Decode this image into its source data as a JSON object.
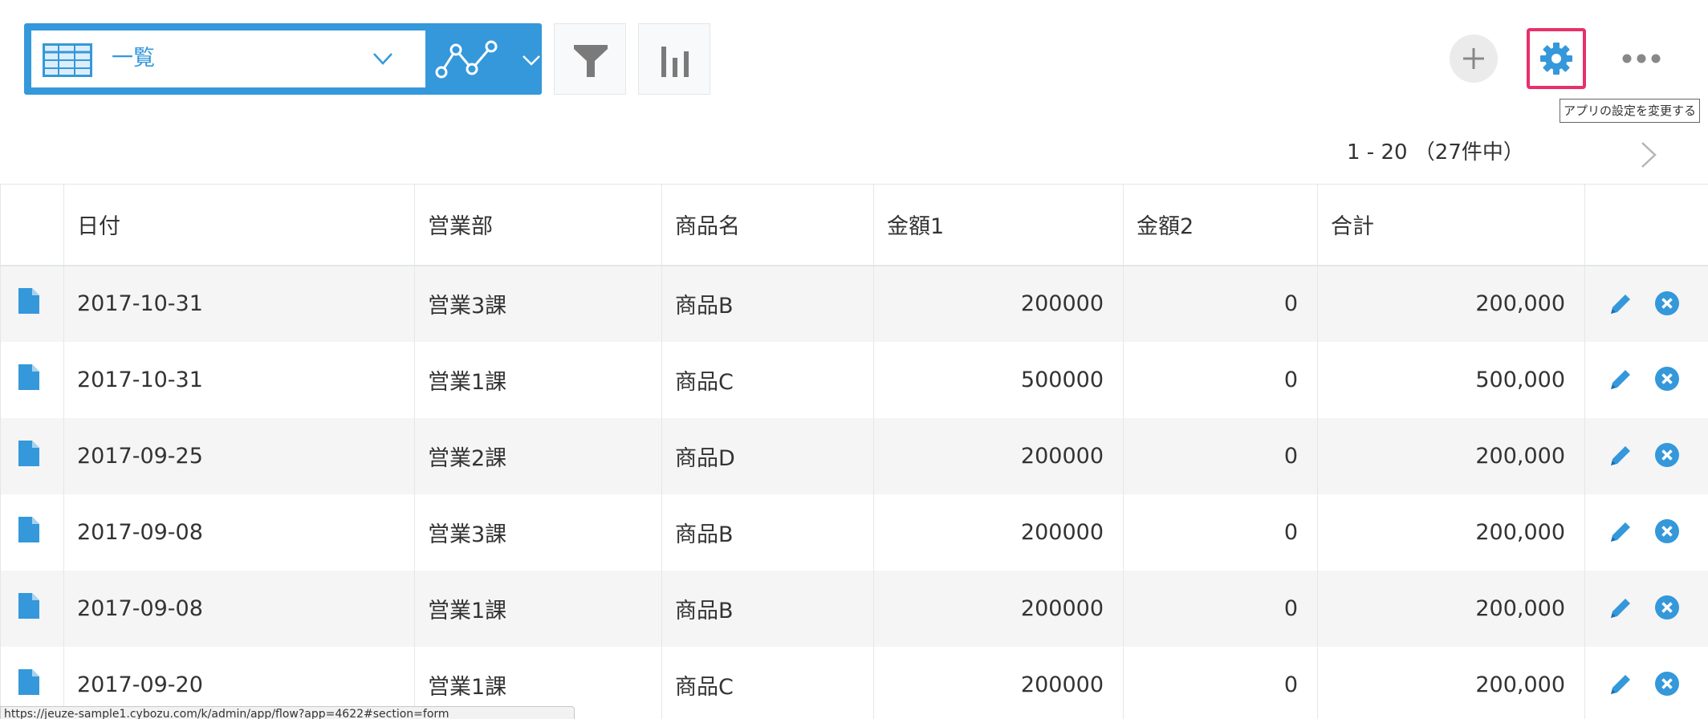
{
  "toolbar": {
    "view_name": "一覧",
    "view_icon": "table-list-icon",
    "graph_icon": "line-graph-icon",
    "filter_icon": "filter-funnel-icon",
    "chart_icon": "bar-chart-icon",
    "add_icon": "plus-icon",
    "settings_icon": "gear-icon",
    "more_icon": "ellipsis-icon",
    "settings_tooltip": "アプリの設定を変更する"
  },
  "pager": {
    "range_text": "1 - 20 （27件中）"
  },
  "table": {
    "columns": [
      "日付",
      "営業部",
      "商品名",
      "金額1",
      "金額2",
      "合計"
    ],
    "rows": [
      {
        "date": "2017-10-31",
        "dept": "営業3課",
        "product": "商品B",
        "amount1": "200000",
        "amount2": "0",
        "total": "200,000"
      },
      {
        "date": "2017-10-31",
        "dept": "営業1課",
        "product": "商品C",
        "amount1": "500000",
        "amount2": "0",
        "total": "500,000"
      },
      {
        "date": "2017-09-25",
        "dept": "営業2課",
        "product": "商品D",
        "amount1": "200000",
        "amount2": "0",
        "total": "200,000"
      },
      {
        "date": "2017-09-08",
        "dept": "営業3課",
        "product": "商品B",
        "amount1": "200000",
        "amount2": "0",
        "total": "200,000"
      },
      {
        "date": "2017-09-08",
        "dept": "営業1課",
        "product": "商品B",
        "amount1": "200000",
        "amount2": "0",
        "total": "200,000"
      },
      {
        "date": "2017-09-20",
        "dept": "営業1課",
        "product": "商品C",
        "amount1": "200000",
        "amount2": "0",
        "total": "200,000"
      }
    ]
  },
  "status_bar": {
    "url": "https://jeuze-sample1.cybozu.com/k/admin/app/flow?app=4622#section=form"
  },
  "colors": {
    "accent": "#3498db",
    "highlight": "#e8306a",
    "row_alt": "#f5f5f5",
    "border": "#e3e7e8"
  }
}
